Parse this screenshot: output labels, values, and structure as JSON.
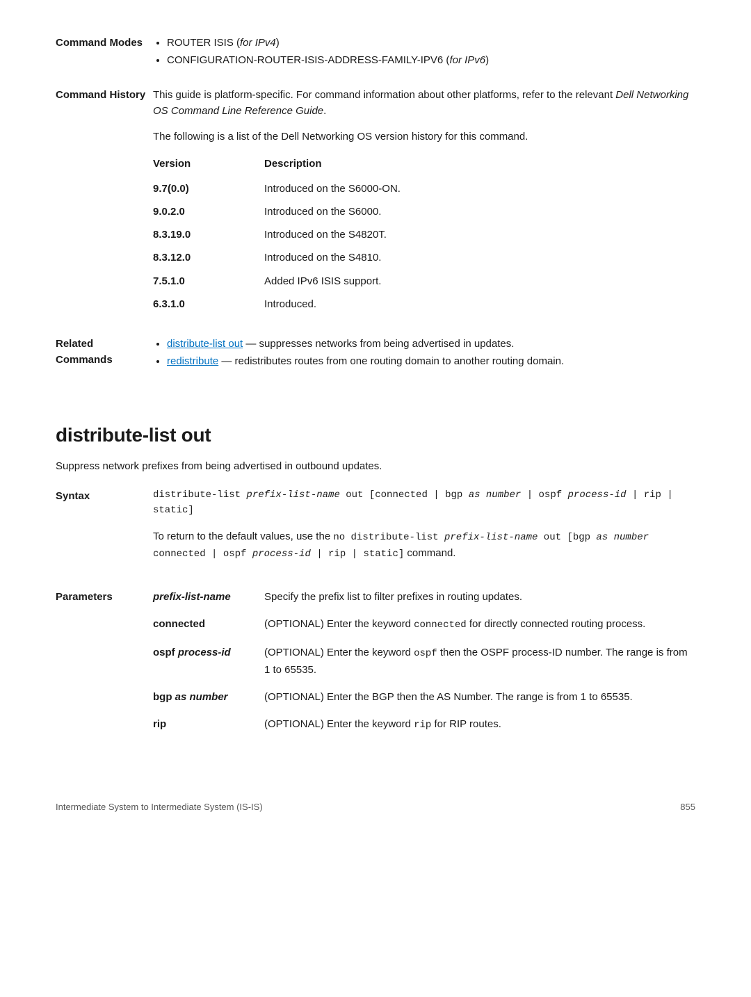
{
  "sections": {
    "command_modes": {
      "label": "Command Modes",
      "items": [
        {
          "pre": "ROUTER ISIS (",
          "ital": "for IPv4",
          "post": ")"
        },
        {
          "pre": "CONFIGURATION-ROUTER-ISIS-ADDRESS-FAMILY-IPV6 (",
          "ital": "for IPv6",
          "post": ")"
        }
      ]
    },
    "command_history": {
      "label": "Command History",
      "para1_pre": "This guide is platform-specific. For command information about other platforms, refer to the relevant ",
      "para1_ital": "Dell Networking OS Command Line Reference Guide",
      "para1_post": ".",
      "para2": "The following is a list of the Dell Networking OS version history for this command.",
      "col1": "Version",
      "col2": "Description",
      "rows": [
        {
          "v": "9.7(0.0)",
          "d": "Introduced on the S6000-ON."
        },
        {
          "v": "9.0.2.0",
          "d": "Introduced on the S6000."
        },
        {
          "v": "8.3.19.0",
          "d": "Introduced on the S4820T."
        },
        {
          "v": "8.3.12.0",
          "d": "Introduced on the S4810."
        },
        {
          "v": "7.5.1.0",
          "d": "Added IPv6 ISIS support."
        },
        {
          "v": "6.3.1.0",
          "d": "Introduced."
        }
      ]
    },
    "related_commands": {
      "label": "Related Commands",
      "items": [
        {
          "link": "distribute-list out",
          "rest": " — suppresses networks from being advertised in updates."
        },
        {
          "link": "redistribute",
          "rest": " — redistributes routes from one routing domain to another routing domain."
        }
      ]
    },
    "distribute": {
      "title": "distribute-list out",
      "intro": "Suppress network prefixes from being advertised in outbound updates.",
      "syntax_label": "Syntax",
      "syntax_code_1": "distribute-list ",
      "syntax_code_ital1": "prefix-list-name",
      "syntax_code_2": " out [connected | bgp ",
      "syntax_code_ital2": "as number",
      "syntax_code_3": " | ospf ",
      "syntax_code_ital3": "process-id",
      "syntax_code_4": " | rip | static]",
      "syntax_ret_1": "To return to the default values, use the ",
      "syntax_ret_mono1": "no distribute-list ",
      "syntax_ret_ital1": "prefix-list-name",
      "syntax_ret_mono2": " out [bgp ",
      "syntax_ret_ital2": "as number",
      "syntax_ret_mono3": " connected | ospf ",
      "syntax_ret_ital3": "process-id",
      "syntax_ret_mono4": " | rip | static]",
      "syntax_ret_2": " command.",
      "params_label": "Parameters",
      "params": [
        {
          "name_ital": "prefix-list-name",
          "desc": "Specify the prefix list to filter prefixes in routing updates."
        },
        {
          "name": "connected",
          "desc_pre": "(OPTIONAL) Enter the keyword ",
          "desc_mono": "connected",
          "desc_post": " for directly connected routing process."
        },
        {
          "name_pre": "ospf ",
          "name_ital": "process-id",
          "desc_pre": "(OPTIONAL) Enter the keyword ",
          "desc_mono": "ospf",
          "desc_post": " then the OSPF process-ID number. The range is from 1 to 65535."
        },
        {
          "name_pre": "bgp ",
          "name_ital": "as number",
          "desc": "(OPTIONAL) Enter the BGP then the AS Number. The range is from 1 to 65535."
        },
        {
          "name": "rip",
          "desc_pre": "(OPTIONAL) Enter the keyword ",
          "desc_mono": "rip",
          "desc_post": " for RIP routes."
        }
      ]
    },
    "footer": {
      "left": "Intermediate System to Intermediate System (IS-IS)",
      "right": "855"
    }
  }
}
